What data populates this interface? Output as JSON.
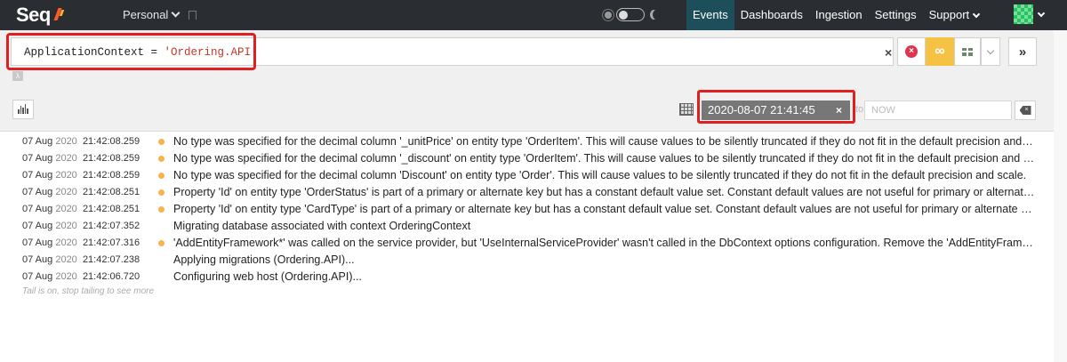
{
  "app": {
    "logo_text": "Seq",
    "workspace": "Personal"
  },
  "nav": [
    {
      "label": "Events",
      "active": true
    },
    {
      "label": "Dashboards"
    },
    {
      "label": "Ingestion"
    },
    {
      "label": "Settings"
    },
    {
      "label": "Support"
    }
  ],
  "query": {
    "prefix": "ApplicationContext = ",
    "string": "'Ordering.API'",
    "clear_label": "×"
  },
  "toolbar": {
    "lambda_label": "λ",
    "expand_label": "»",
    "tail_icon": "∞"
  },
  "date_range": {
    "from": "2020-08-07 21:41:45",
    "from_clear": "×",
    "to_label": "to",
    "to_placeholder": "NOW"
  },
  "events": [
    {
      "date": "07 Aug",
      "year": "2020",
      "time": "21:42:08.259",
      "level": "warning",
      "message": "No type was specified for the decimal column '_unitPrice' on entity type 'OrderItem'. This will cause values to be silently truncated if they do not fit in the default precision and scale."
    },
    {
      "date": "07 Aug",
      "year": "2020",
      "time": "21:42:08.259",
      "level": "warning",
      "message": "No type was specified for the decimal column '_discount' on entity type 'OrderItem'. This will cause values to be silently truncated if they do not fit in the default precision and scale."
    },
    {
      "date": "07 Aug",
      "year": "2020",
      "time": "21:42:08.259",
      "level": "warning",
      "message": "No type was specified for the decimal column 'Discount' on entity type 'Order'. This will cause values to be silently truncated if they do not fit in the default precision and scale."
    },
    {
      "date": "07 Aug",
      "year": "2020",
      "time": "21:42:08.251",
      "level": "warning",
      "message": "Property 'Id' on entity type 'OrderStatus' is part of a primary or alternate key but has a constant default value set. Constant default values are not useful for primary or alternate keys."
    },
    {
      "date": "07 Aug",
      "year": "2020",
      "time": "21:42:08.251",
      "level": "warning",
      "message": "Property 'Id' on entity type 'CardType' is part of a primary or alternate key but has a constant default value set. Constant default values are not useful for primary or alternate keys."
    },
    {
      "date": "07 Aug",
      "year": "2020",
      "time": "21:42:07.352",
      "level": "info",
      "message": "Migrating database associated with context OrderingContext"
    },
    {
      "date": "07 Aug",
      "year": "2020",
      "time": "21:42:07.316",
      "level": "warning",
      "message": "'AddEntityFramework*' was called on the service provider, but 'UseInternalServiceProvider' wasn't called in the DbContext options configuration. Remove the 'AddEntityFramework*' calls."
    },
    {
      "date": "07 Aug",
      "year": "2020",
      "time": "21:42:07.238",
      "level": "info",
      "message": "Applying migrations (Ordering.API)..."
    },
    {
      "date": "07 Aug",
      "year": "2020",
      "time": "21:42:06.720",
      "level": "info",
      "message": "Configuring web host (Ordering.API)..."
    }
  ],
  "tail_note": "Tail is on, stop tailing to see more",
  "colors": {
    "topbar": "#2a2d31",
    "active_nav": "#1c4f5a",
    "warning_dot": "#f6b44a",
    "tail_button": "#f6c244",
    "highlight": "#e02020"
  }
}
